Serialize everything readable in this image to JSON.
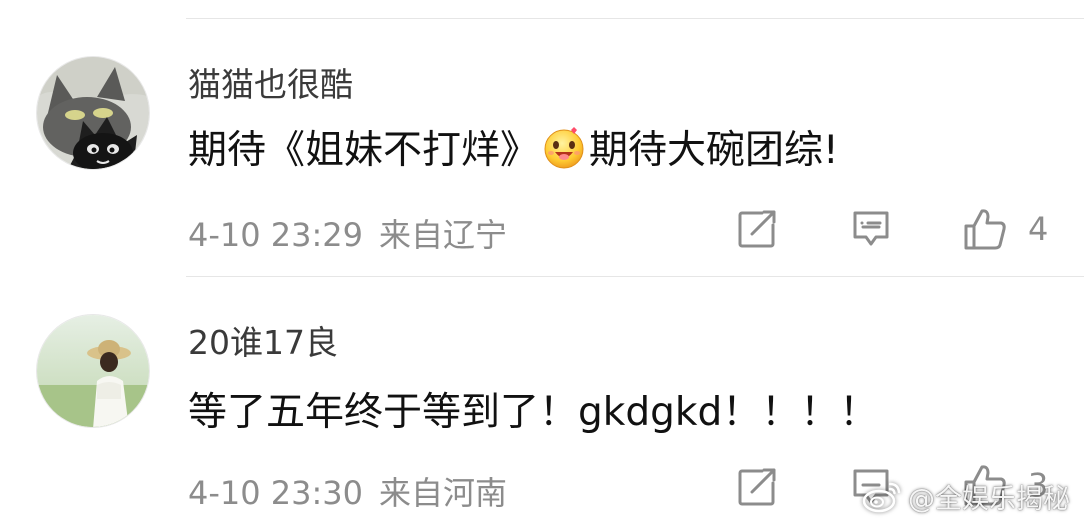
{
  "comments": [
    {
      "username": "猫猫也很酷",
      "content_before_emoji": "期待《姐妹不打烊》",
      "emoji_icon": "grinning-face-emoji-icon",
      "content_after_emoji": "期待大碗团综!",
      "time": "4-10 23:29",
      "location": "来自辽宁",
      "like_count": "4"
    },
    {
      "username": "20谁17良",
      "content": "等了五年终于等到了！gkdgkd！！！！",
      "time": "4-10 23:30",
      "location": "来自河南",
      "like_count": "3"
    }
  ],
  "icons": {
    "share": "share-icon",
    "reply": "comment-icon",
    "like": "thumbs-up-icon",
    "watermark_logo": "weibo-logo-icon"
  },
  "watermark": {
    "text": "@全娱乐揭秘"
  },
  "colors": {
    "text_primary": "#111111",
    "text_secondary": "#8c8c8c",
    "divider": "#e6e6e6"
  }
}
